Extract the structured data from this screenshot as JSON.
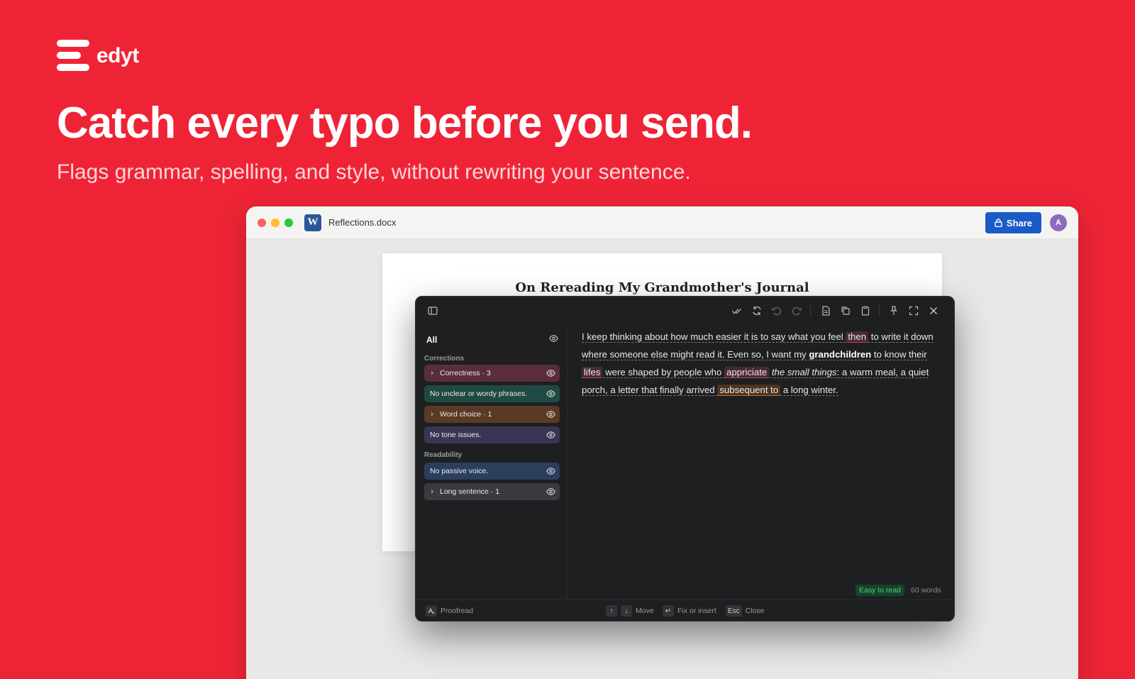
{
  "brand": {
    "name": "edyt",
    "logo_icon": "edyt-logo-icon"
  },
  "hero": {
    "title": "Catch every typo before you send.",
    "subtitle": "Flags grammar, spelling, and style, without rewriting your sentence."
  },
  "window": {
    "doc_name": "Reflections.docx",
    "app_icon_letter": "W",
    "share_label": "Share",
    "avatar_initial": "A"
  },
  "document": {
    "title": "On Rereading My Grandmother's Journal"
  },
  "panel": {
    "sidebar": {
      "all_label": "All",
      "groups": [
        {
          "label": "Corrections"
        },
        {
          "label": "Readability"
        }
      ],
      "items": [
        {
          "label": "Correctness · 3",
          "expandable": true,
          "color": "#5A2D3B"
        },
        {
          "label": "No unclear or wordy phrases.",
          "expandable": false,
          "color": "#1F4A43"
        },
        {
          "label": "Word choice · 1",
          "expandable": true,
          "color": "#5A3A24"
        },
        {
          "label": "No tone issues.",
          "expandable": false,
          "color": "#3A3554"
        },
        {
          "label": "No passive voice.",
          "expandable": false,
          "color": "#2B3E5C"
        },
        {
          "label": "Long sentence · 1",
          "expandable": true,
          "color": "#3A3B3E"
        }
      ]
    },
    "text": {
      "s1": "I keep thinking about how much easier it is to say what you feel ",
      "f1": "then",
      "s2": " to write it down where someone else might read it. Even so, I want my ",
      "b1": "grandchildren",
      "s3": " to know their ",
      "f2": "lifes",
      "s4": " were shaped by people who ",
      "f3": "appriciate",
      "s5": " ",
      "i1": "the small things",
      "s6": ": a warm meal, a quiet porch, a letter that finally arrived ",
      "f4": "subsequent to",
      "s7": " a long winter."
    },
    "status": {
      "readability": "Easy to read",
      "word_count": "60 words"
    },
    "footer": {
      "proofread_label": "Proofread",
      "move_label": "Move",
      "fix_label": "Fix or insert",
      "esc_key": "Esc",
      "close_label": "Close"
    }
  },
  "colors": {
    "background": "#EE2436",
    "share": "#1B5BC7",
    "correctness_flag": "#B8405A",
    "word_choice_flag": "#C66A2D",
    "readability_badge": "#4CD27E"
  }
}
